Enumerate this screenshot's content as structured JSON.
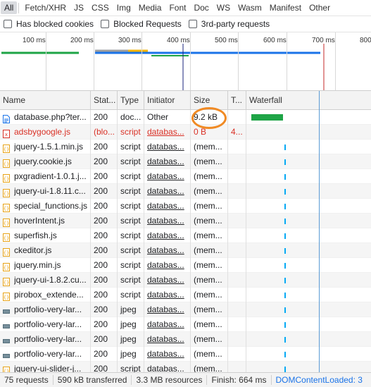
{
  "filters": {
    "types": [
      "All",
      "Fetch/XHR",
      "JS",
      "CSS",
      "Img",
      "Media",
      "Font",
      "Doc",
      "WS",
      "Wasm",
      "Manifest",
      "Other"
    ],
    "checkboxes": [
      "Has blocked cookies",
      "Blocked Requests",
      "3rd-party requests"
    ]
  },
  "overview": {
    "ticks": [
      "100 ms",
      "200 ms",
      "300 ms",
      "400 ms",
      "500 ms",
      "600 ms",
      "700 ms",
      "800"
    ],
    "colors": {
      "doc": "#1ea446",
      "script": "#f4b400",
      "load": "#1a73e8",
      "dcl_marker": "#1a237e",
      "load_marker": "#c62828"
    }
  },
  "table": {
    "headers": [
      "Name",
      "Stat...",
      "Type",
      "Initiator",
      "Size",
      "T...",
      "Waterfall"
    ],
    "rows": [
      {
        "icon": "document-icon",
        "name": "database.php?ter...",
        "status": "200",
        "type": "doc...",
        "initiator": "Other",
        "size": "9.2 kB",
        "time": "",
        "error": false
      },
      {
        "icon": "script-error-icon",
        "name": "adsbygoogle.js",
        "status": "(blo...",
        "type": "script",
        "initiator": "databas...",
        "size": "0 B",
        "time": "4...",
        "error": true
      },
      {
        "icon": "script-icon",
        "name": "jquery-1.5.1.min.js",
        "status": "200",
        "type": "script",
        "initiator": "databas...",
        "size": "(mem...",
        "time": "",
        "error": false
      },
      {
        "icon": "script-icon",
        "name": "jquery.cookie.js",
        "status": "200",
        "type": "script",
        "initiator": "databas...",
        "size": "(mem...",
        "time": "",
        "error": false
      },
      {
        "icon": "script-icon",
        "name": "pxgradient-1.0.1.j...",
        "status": "200",
        "type": "script",
        "initiator": "databas...",
        "size": "(mem...",
        "time": "",
        "error": false
      },
      {
        "icon": "script-icon",
        "name": "jquery-ui-1.8.11.c...",
        "status": "200",
        "type": "script",
        "initiator": "databas...",
        "size": "(mem...",
        "time": "",
        "error": false
      },
      {
        "icon": "script-icon",
        "name": "special_functions.js",
        "status": "200",
        "type": "script",
        "initiator": "databas...",
        "size": "(mem...",
        "time": "",
        "error": false
      },
      {
        "icon": "script-icon",
        "name": "hoverIntent.js",
        "status": "200",
        "type": "script",
        "initiator": "databas...",
        "size": "(mem...",
        "time": "",
        "error": false
      },
      {
        "icon": "script-icon",
        "name": "superfish.js",
        "status": "200",
        "type": "script",
        "initiator": "databas...",
        "size": "(mem...",
        "time": "",
        "error": false
      },
      {
        "icon": "script-icon",
        "name": "ckeditor.js",
        "status": "200",
        "type": "script",
        "initiator": "databas...",
        "size": "(mem...",
        "time": "",
        "error": false
      },
      {
        "icon": "script-icon",
        "name": "jquery.min.js",
        "status": "200",
        "type": "script",
        "initiator": "databas...",
        "size": "(mem...",
        "time": "",
        "error": false
      },
      {
        "icon": "script-icon",
        "name": "jquery-ui-1.8.2.cu...",
        "status": "200",
        "type": "script",
        "initiator": "databas...",
        "size": "(mem...",
        "time": "",
        "error": false
      },
      {
        "icon": "script-icon",
        "name": "pirobox_extende...",
        "status": "200",
        "type": "script",
        "initiator": "databas...",
        "size": "(mem...",
        "time": "",
        "error": false
      },
      {
        "icon": "image-icon",
        "name": "portfolio-very-lar...",
        "status": "200",
        "type": "jpeg",
        "initiator": "databas...",
        "size": "(mem...",
        "time": "",
        "error": false
      },
      {
        "icon": "image-icon",
        "name": "portfolio-very-lar...",
        "status": "200",
        "type": "jpeg",
        "initiator": "databas...",
        "size": "(mem...",
        "time": "",
        "error": false
      },
      {
        "icon": "image-icon",
        "name": "portfolio-very-lar...",
        "status": "200",
        "type": "jpeg",
        "initiator": "databas...",
        "size": "(mem...",
        "time": "",
        "error": false
      },
      {
        "icon": "image-icon",
        "name": "portfolio-very-lar...",
        "status": "200",
        "type": "jpeg",
        "initiator": "databas...",
        "size": "(mem...",
        "time": "",
        "error": false
      },
      {
        "icon": "script-icon",
        "name": "jquery-ui-slider-j...",
        "status": "200",
        "type": "script",
        "initiator": "databas...",
        "size": "(mem...",
        "time": "",
        "error": false
      }
    ]
  },
  "status": {
    "requests": "75 requests",
    "transferred": "590 kB transferred",
    "resources": "3.3 MB resources",
    "finish": "Finish: 664 ms",
    "dcl": "DOMContentLoaded: 3"
  }
}
